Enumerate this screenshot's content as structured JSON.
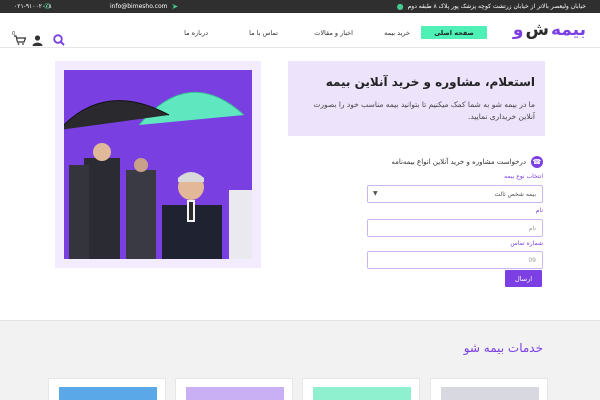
{
  "topbar": {
    "address": "خیابان ولیعصر بالاتر از خیابان زرتشت کوچه پزشک پور پلاک ۸ طبقه دوم",
    "email": "info@bimesho.com",
    "phone": "۰۲۱-۹۱۰۰۲۰۰۸"
  },
  "header": {
    "logo_parts": [
      "بیمه",
      "ش",
      "و"
    ],
    "nav": {
      "home": "صفحه اصلی",
      "buy": "خرید بیمه",
      "news": "اخبار و مقالات",
      "contact": "تماس با ما",
      "about": "درباره ما"
    },
    "icons": [
      "search-icon",
      "user-icon",
      "cart-icon"
    ],
    "cart_count": "0"
  },
  "hero": {
    "title": "استعلام، مشاوره و خرید آنلاین بیمه",
    "description": "ما در بیمه شو به شما کمک میکنیم تا بتوانید بیمه مناسب خود را بصورت آنلاین خریداری نمایید."
  },
  "form": {
    "heading": "درخواست مشاوره و خرید آنلاین انواع بیمه‌نامه",
    "type_label": "انتخاب نوع بیمه",
    "type_value": "بیمه شخص ثالث",
    "name_label": "نام",
    "name_placeholder": "نام",
    "phone_label": "شماره تماس",
    "phone_placeholder": "09",
    "submit": "ارسال"
  },
  "services": {
    "title": "خدمات بیمه شو"
  },
  "colors": {
    "accent": "#7b3fe4",
    "mint": "#4ef0b6",
    "topbar": "#2f2f2f",
    "panel": "#ede4fb"
  }
}
